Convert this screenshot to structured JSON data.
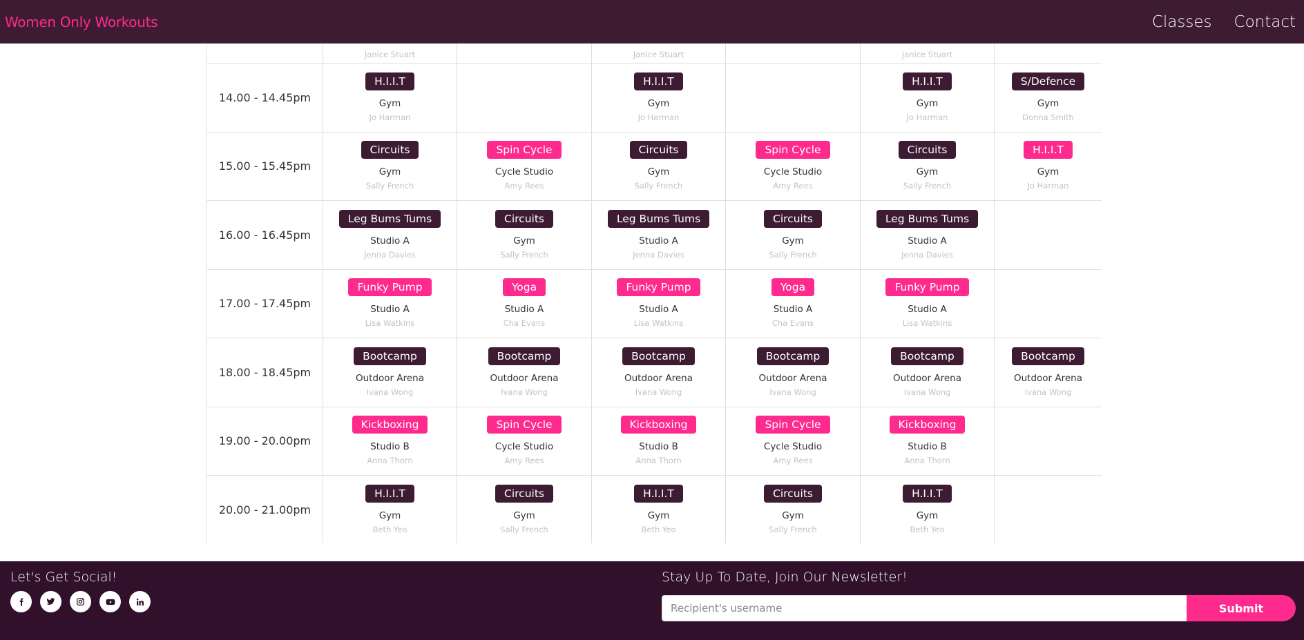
{
  "nav": {
    "brand": "Women Only Workouts",
    "links": [
      "Classes",
      "Contact"
    ]
  },
  "schedule": {
    "partial_row": [
      "",
      "Janice Stuart",
      "",
      "Janice Stuart",
      "",
      "Janice Stuart",
      ""
    ],
    "rows": [
      {
        "time": "14.00 - 14.45pm",
        "cells": [
          {
            "name": "H.I.I.T",
            "color": "dark",
            "location": "Gym",
            "instructor": "Jo Harman"
          },
          null,
          {
            "name": "H.I.I.T",
            "color": "dark",
            "location": "Gym",
            "instructor": "Jo Harman"
          },
          null,
          {
            "name": "H.I.I.T",
            "color": "dark",
            "location": "Gym",
            "instructor": "Jo Harman"
          },
          {
            "name": "S/Defence",
            "color": "dark",
            "location": "Gym",
            "instructor": "Donna Smith"
          }
        ]
      },
      {
        "time": "15.00 - 15.45pm",
        "cells": [
          {
            "name": "Circuits",
            "color": "dark",
            "location": "Gym",
            "instructor": "Sally French"
          },
          {
            "name": "Spin Cycle",
            "color": "pink",
            "location": "Cycle Studio",
            "instructor": "Amy Rees"
          },
          {
            "name": "Circuits",
            "color": "dark",
            "location": "Gym",
            "instructor": "Sally French"
          },
          {
            "name": "Spin Cycle",
            "color": "pink",
            "location": "Cycle Studio",
            "instructor": "Amy Rees"
          },
          {
            "name": "Circuits",
            "color": "dark",
            "location": "Gym",
            "instructor": "Sally French"
          },
          {
            "name": "H.I.I.T",
            "color": "pink",
            "location": "Gym",
            "instructor": "Jo Harman"
          }
        ]
      },
      {
        "time": "16.00 - 16.45pm",
        "cells": [
          {
            "name": "Leg Bums Tums",
            "color": "dark",
            "location": "Studio A",
            "instructor": "Jenna Davies"
          },
          {
            "name": "Circuits",
            "color": "dark",
            "location": "Gym",
            "instructor": "Sally French"
          },
          {
            "name": "Leg Bums Tums",
            "color": "dark",
            "location": "Studio A",
            "instructor": "Jenna Davies"
          },
          {
            "name": "Circuits",
            "color": "dark",
            "location": "Gym",
            "instructor": "Sally French"
          },
          {
            "name": "Leg Bums Tums",
            "color": "dark",
            "location": "Studio A",
            "instructor": "Jenna Davies"
          },
          null
        ]
      },
      {
        "time": "17.00 - 17.45pm",
        "cells": [
          {
            "name": "Funky Pump",
            "color": "pink",
            "location": "Studio A",
            "instructor": "Lisa Watkins"
          },
          {
            "name": "Yoga",
            "color": "pink",
            "location": "Studio A",
            "instructor": "Cha Evans"
          },
          {
            "name": "Funky Pump",
            "color": "pink",
            "location": "Studio A",
            "instructor": "Lisa Watkins"
          },
          {
            "name": "Yoga",
            "color": "pink",
            "location": "Studio A",
            "instructor": "Cha Evans"
          },
          {
            "name": "Funky Pump",
            "color": "pink",
            "location": "Studio A",
            "instructor": "Lisa Watkins"
          },
          null
        ]
      },
      {
        "time": "18.00 - 18.45pm",
        "cells": [
          {
            "name": "Bootcamp",
            "color": "dark",
            "location": "Outdoor Arena",
            "instructor": "Ivana Wong"
          },
          {
            "name": "Bootcamp",
            "color": "dark",
            "location": "Outdoor Arena",
            "instructor": "Ivana Wong"
          },
          {
            "name": "Bootcamp",
            "color": "dark",
            "location": "Outdoor Arena",
            "instructor": "Ivana Wong"
          },
          {
            "name": "Bootcamp",
            "color": "dark",
            "location": "Outdoor Arena",
            "instructor": "Ivana Wong"
          },
          {
            "name": "Bootcamp",
            "color": "dark",
            "location": "Outdoor Arena",
            "instructor": "Ivana Wong"
          },
          {
            "name": "Bootcamp",
            "color": "dark",
            "location": "Outdoor Arena",
            "instructor": "Ivana Wong"
          }
        ]
      },
      {
        "time": "19.00 - 20.00pm",
        "cells": [
          {
            "name": "Kickboxing",
            "color": "pink",
            "location": "Studio B",
            "instructor": "Anna Thorn"
          },
          {
            "name": "Spin Cycle",
            "color": "pink",
            "location": "Cycle Studio",
            "instructor": "Amy Rees"
          },
          {
            "name": "Kickboxing",
            "color": "pink",
            "location": "Studio B",
            "instructor": "Anna Thorn"
          },
          {
            "name": "Spin Cycle",
            "color": "pink",
            "location": "Cycle Studio",
            "instructor": "Amy Rees"
          },
          {
            "name": "Kickboxing",
            "color": "pink",
            "location": "Studio B",
            "instructor": "Anna Thorn"
          },
          null
        ]
      },
      {
        "time": "20.00 - 21.00pm",
        "cells": [
          {
            "name": "H.I.I.T",
            "color": "dark",
            "location": "Gym",
            "instructor": "Beth Yeo"
          },
          {
            "name": "Circuits",
            "color": "dark",
            "location": "Gym",
            "instructor": "Sally French"
          },
          {
            "name": "H.I.I.T",
            "color": "dark",
            "location": "Gym",
            "instructor": "Beth Yeo"
          },
          {
            "name": "Circuits",
            "color": "dark",
            "location": "Gym",
            "instructor": "Sally French"
          },
          {
            "name": "H.I.I.T",
            "color": "dark",
            "location": "Gym",
            "instructor": "Beth Yeo"
          },
          null
        ]
      }
    ]
  },
  "footer": {
    "social_title": "Let's Get Social!",
    "social_icons": [
      "facebook-icon",
      "twitter-icon",
      "instagram-icon",
      "youtube-icon",
      "linkedin-icon"
    ],
    "newsletter_title": "Stay Up To Date, Join Our Newsletter!",
    "newsletter_placeholder": "Recipient's username",
    "submit_label": "Submit"
  },
  "colors": {
    "brand_dark": "#3c1b33",
    "footer_bg": "#30102a",
    "accent_pink": "#ff2a8d"
  }
}
